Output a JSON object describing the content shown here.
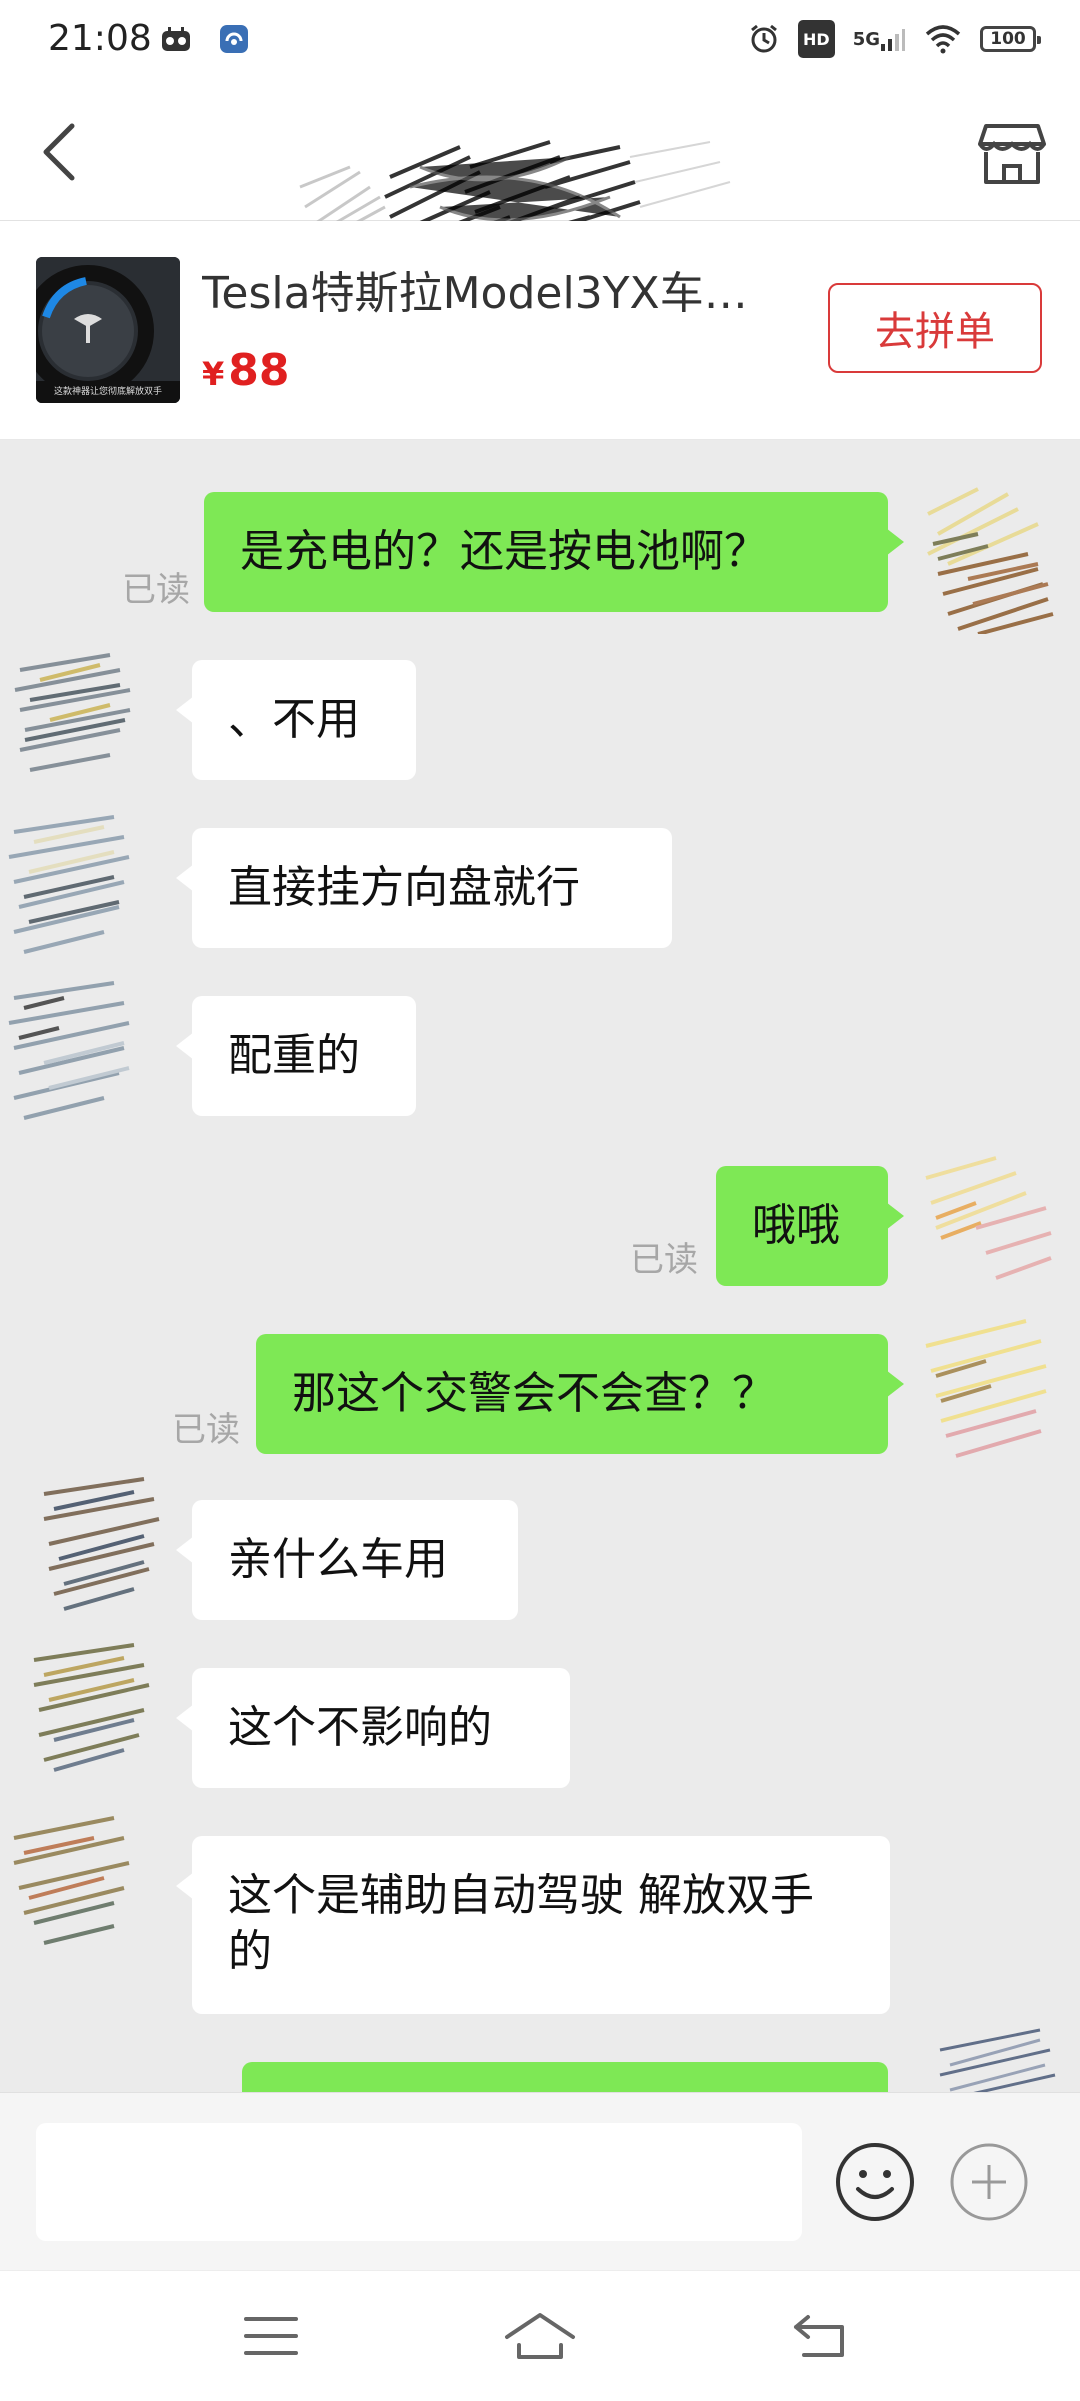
{
  "status_bar": {
    "time": "21:08",
    "left_icons": [
      "notification-app-icon",
      "notification-app2-icon"
    ],
    "right_icons": [
      "alarm-icon",
      "hd-icon",
      "signal-5g-icon",
      "wifi-icon",
      "battery-icon"
    ],
    "hd": "HD",
    "network": "5G",
    "battery": "100"
  },
  "nav": {
    "back_icon": "chevron-left-icon",
    "shop_icon": "store-icon"
  },
  "product": {
    "title": "Tesla特斯拉Model3YX车…",
    "currency": "¥",
    "price": "88",
    "button": "去拼单",
    "image_caption": "这款神器让您彻底解放双手"
  },
  "messages": [
    {
      "side": "out",
      "text": "是充电的？还是按电池啊？",
      "read": "已读"
    },
    {
      "side": "in",
      "text": "、不用"
    },
    {
      "side": "in",
      "text": "直接挂方向盘就行"
    },
    {
      "side": "in",
      "text": "配重的"
    },
    {
      "side": "out",
      "text": "哦哦",
      "read": "已读"
    },
    {
      "side": "out",
      "text": "那这个交警会不会查？？",
      "read": "已读"
    },
    {
      "side": "in",
      "text": "亲什么车用"
    },
    {
      "side": "in",
      "text": "这个不影响的"
    },
    {
      "side": "in",
      "text": "这个是辅助自动驾驶 解放双手的"
    },
    {
      "side": "out",
      "text": ""
    }
  ],
  "input": {
    "value": "",
    "emoji_icon": "emoji-icon",
    "plus_icon": "plus-circle-icon"
  },
  "system_nav": {
    "menu_icon": "menu-icon",
    "home_icon": "home-icon",
    "back_icon": "back-icon"
  },
  "colors": {
    "outgoing_bubble": "#7ee855",
    "incoming_bubble": "#ffffff",
    "chat_background": "#ebebeb",
    "price": "#e02020",
    "button_border": "#d93a3a"
  }
}
